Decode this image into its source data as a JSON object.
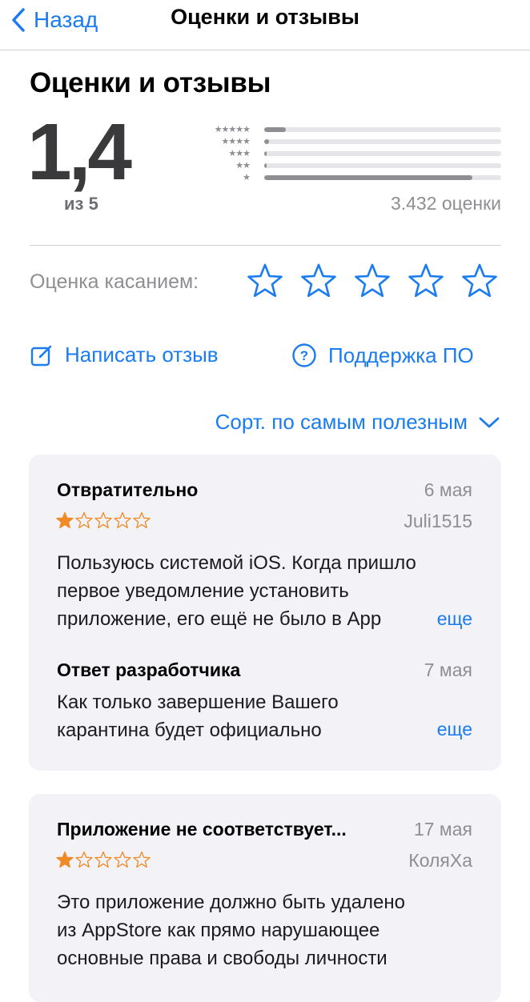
{
  "nav": {
    "back_label": "Назад",
    "title": "Оценки и отзывы"
  },
  "ratings": {
    "section_title": "Оценки и отзывы",
    "average": "1,4",
    "out_of": "из 5",
    "count": "3.432 оценки",
    "distribution": [
      {
        "stars": "★★★★★",
        "fraction": 0.09
      },
      {
        "stars": "★★★★",
        "fraction": 0.02
      },
      {
        "stars": "★★★",
        "fraction": 0.01
      },
      {
        "stars": "★★",
        "fraction": 0.01
      },
      {
        "stars": "★",
        "fraction": 0.88
      }
    ]
  },
  "tap_rate": {
    "label": "Оценка касанием:",
    "stars": 5
  },
  "actions": {
    "write_review": "Написать отзыв",
    "support": "Поддержка ПО"
  },
  "sort": {
    "label": "Сорт. по самым полезным"
  },
  "reviews": [
    {
      "title": "Отвратительно",
      "date": "6 мая",
      "author": "Juli1515",
      "rating": 1,
      "body_lines": [
        "Пользуюсь системой iOS. Когда пришло",
        "первое уведомление установить",
        "приложение, его ещё не было в App"
      ],
      "more": "еще",
      "developer_response": {
        "title": "Ответ разработчика",
        "date": "7 мая",
        "body_lines": [
          "Как только завершение Вашего",
          "карантина будет официально"
        ],
        "more": "еще"
      }
    },
    {
      "title": "Приложение не соответствует...",
      "date": "17 мая",
      "author": "КоляХа",
      "rating": 1,
      "body_lines": [
        "Это приложение должно быть удалено",
        "из AppStore как прямо нарушающее",
        "основные права и свободы личности"
      ]
    }
  ],
  "colors": {
    "accent": "#1a7cf0",
    "star_filled": "#f08a24",
    "card_bg": "#f2f2f7",
    "secondary_text": "#8e8e93"
  }
}
